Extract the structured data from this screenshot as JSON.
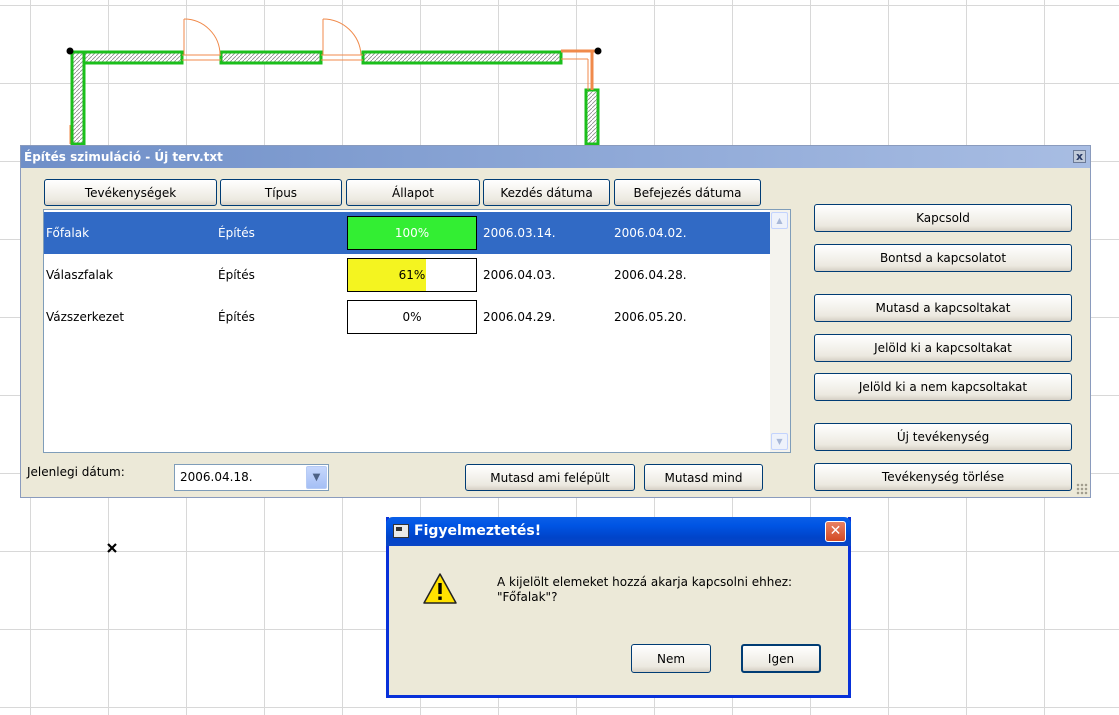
{
  "main_window": {
    "title": "Építés szimuláció - Új terv.txt",
    "close_glyph": "x",
    "columns": [
      "Tevékenységek",
      "Típus",
      "Állapot",
      "Kezdés dátuma",
      "Befejezés dátuma"
    ],
    "rows": [
      {
        "name": "Főfalak",
        "type": "Építés",
        "progress_label": "100%",
        "progress": 1.0,
        "bar_color": "#33ee33",
        "start": "2006.03.14.",
        "end": "2006.04.02.",
        "selected": true
      },
      {
        "name": "Válaszfalak",
        "type": "Építés",
        "progress_label": "61%",
        "progress": 0.61,
        "bar_color": "#f4f420",
        "start": "2006.04.03.",
        "end": "2006.04.28.",
        "selected": false
      },
      {
        "name": "Vázszerkezet",
        "type": "Építés",
        "progress_label": "0%",
        "progress": 0.0,
        "bar_color": "#ffffff",
        "start": "2006.04.29.",
        "end": "2006.05.20.",
        "selected": false
      }
    ],
    "side_buttons": [
      "Kapcsold",
      "Bontsd a kapcsolatot",
      "Mutasd a kapcsoltakat",
      "Jelöld ki a kapcsoltakat",
      "Jelöld ki a nem kapcsoltakat",
      "Új tevékenység",
      "Tevékenység törlése"
    ],
    "current_date_label": "Jelenlegi dátum:",
    "current_date_value": "2006.04.18.",
    "show_built_button": "Mutasd ami felépült",
    "show_all_button": "Mutasd mind"
  },
  "dialog": {
    "title": "Figyelmeztetés!",
    "message_line1": "A kijelölt elemeket hozzá akarja kapcsolni ehhez:",
    "message_line2": "\"Főfalak\"?",
    "no_button": "Nem",
    "yes_button": "Igen"
  },
  "colors": {
    "selection": "#316ac5",
    "wall_outline": "#1bbf1b",
    "window_frame": "#f08a4b",
    "dialog_title": "#0054e3"
  }
}
